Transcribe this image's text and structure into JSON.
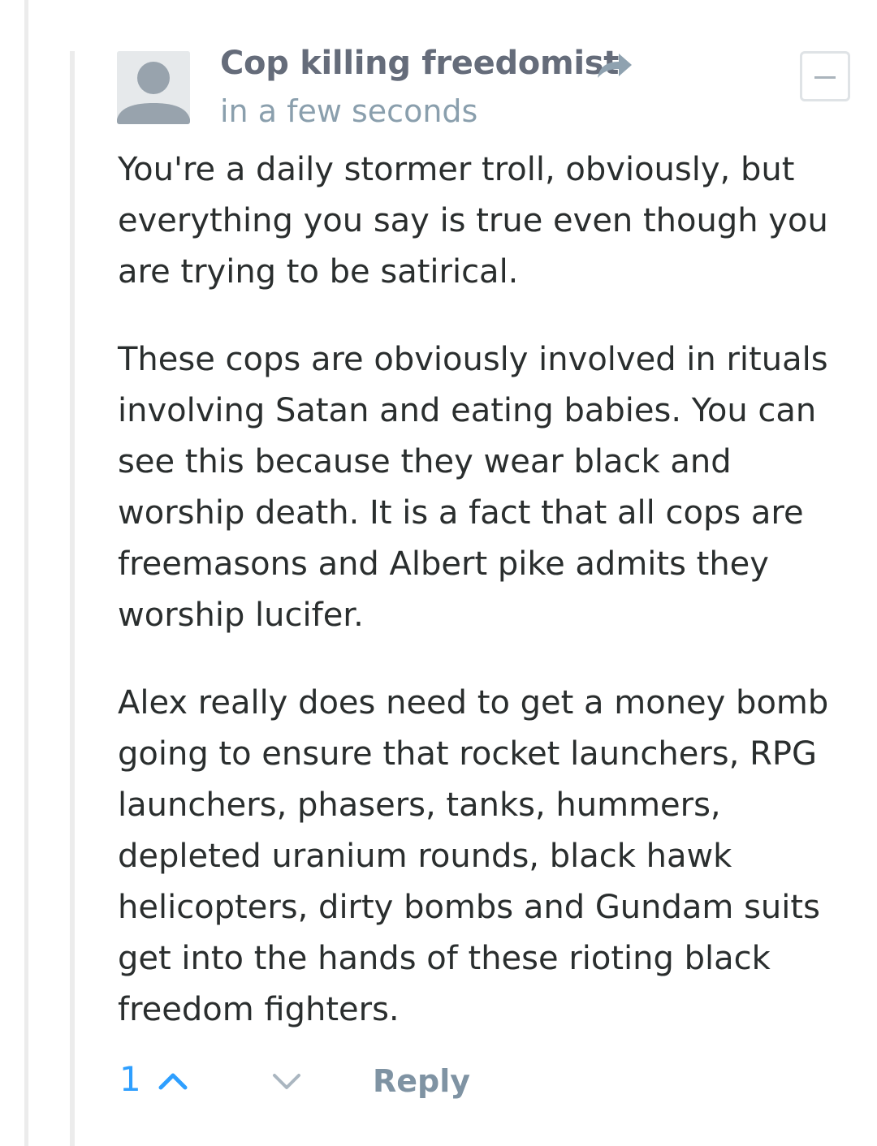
{
  "comment": {
    "author": "Cop killing freedomist",
    "timestamp": "in a few seconds",
    "paragraphs": [
      "You're a daily stormer troll, obviously, but\neverything you say is true even though you\nare trying to be satirical.",
      "These cops are obviously involved in rituals\ninvolving Satan and eating babies. You can\nsee this because they wear black and\nworship death. It is a fact that all cops are\nfreemasons and Albert pike admits they\nworship lucifer.",
      "Alex really does need to get a money bomb\ngoing to ensure that rocket launchers, RPG\nlaunchers, phasers, tanks, hummers,\ndepleted uranium rounds, black hawk\nhelicopters, dirty bombs and Gundam suits\nget into the hands of these rioting black\nfreedom fighters."
    ],
    "votes": "1",
    "reply_label": "Reply",
    "icons": {
      "avatar": "default-avatar-icon",
      "share": "share-arrow-icon",
      "collapse": "minus-icon",
      "upvote": "chevron-up-icon",
      "downvote": "chevron-down-icon"
    },
    "colors": {
      "author": "#656c7a",
      "timestamp": "#8a9fad",
      "body": "#2a2e2e",
      "votes": "#2e9fff",
      "reply": "#7f93a3"
    }
  }
}
